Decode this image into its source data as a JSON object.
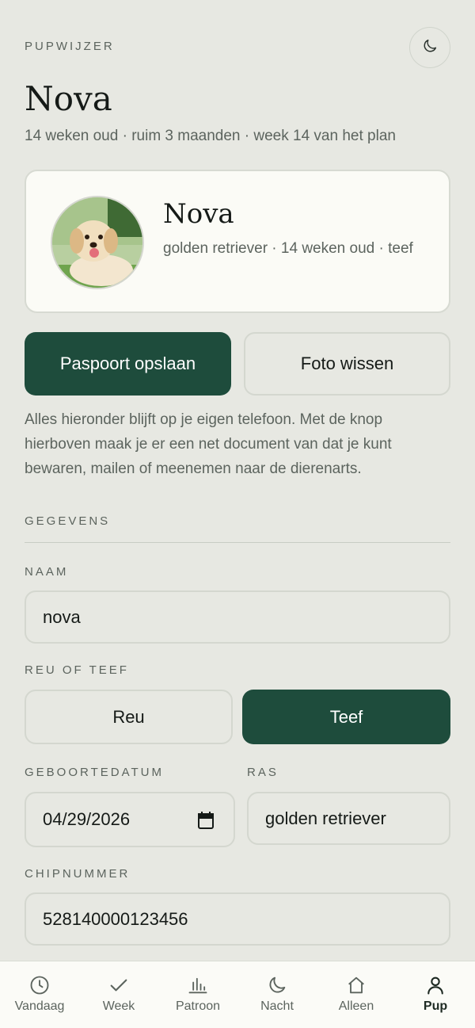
{
  "header": {
    "app_label": "PUPWIJZER",
    "title": "Nova",
    "subtitle": "14 weken oud · ruim 3 maanden · week 14 van het plan"
  },
  "profile_card": {
    "name": "Nova",
    "details": "golden retriever · 14 weken oud · teef"
  },
  "actions": {
    "save_label": "Paspoort opslaan",
    "clear_photo_label": "Foto wissen"
  },
  "info_text": "Alles hieronder blijft op je eigen telefoon. Met de knop hierboven maak je er een net document van dat je kunt bewaren, mailen of meenemen naar de dierenarts.",
  "form": {
    "section_label": "GEGEVENS",
    "name_label": "NAAM",
    "name_value": "nova",
    "sex_label": "REU OF TEEF",
    "sex_options": [
      "Reu",
      "Teef"
    ],
    "sex_selected": "Teef",
    "birthdate_label": "GEBOORTEDATUM",
    "birthdate_value": "04/29/2026",
    "breed_label": "RAS",
    "breed_value": "golden retriever",
    "chip_label": "CHIPNUMMER",
    "chip_value": "528140000123456"
  },
  "tabbar": {
    "items": [
      {
        "label": "Vandaag",
        "icon": "clock-icon"
      },
      {
        "label": "Week",
        "icon": "check-icon"
      },
      {
        "label": "Patroon",
        "icon": "bar-chart-icon"
      },
      {
        "label": "Nacht",
        "icon": "moon-icon"
      },
      {
        "label": "Alleen",
        "icon": "home-icon"
      },
      {
        "label": "Pup",
        "icon": "user-icon"
      }
    ],
    "active": "Pup"
  },
  "colors": {
    "background": "#e7e8e2",
    "accent": "#1e4c3c",
    "card": "#fbfbf6",
    "muted_text": "#5c645e"
  }
}
